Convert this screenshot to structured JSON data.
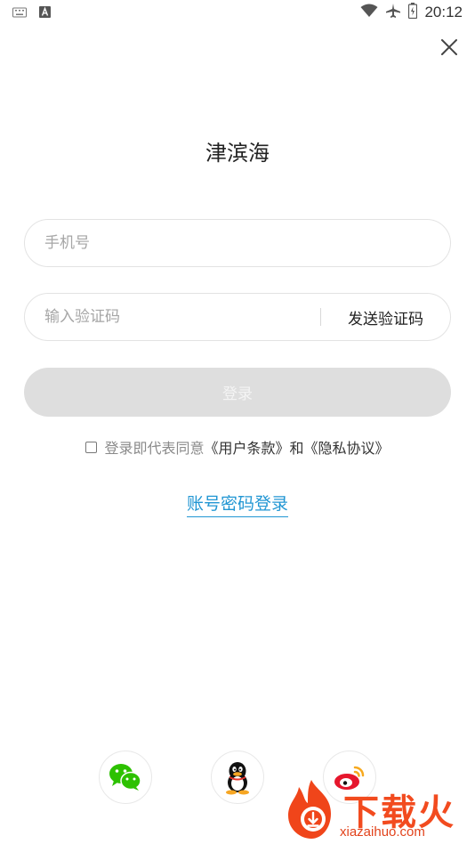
{
  "status_bar": {
    "time": "20:12",
    "left_icons": [
      "keyboard-icon",
      "a-icon"
    ],
    "right_icons": [
      "wifi-icon",
      "airplane-icon",
      "battery-icon"
    ]
  },
  "header": {
    "close_icon": "close-icon"
  },
  "app": {
    "title": "津滨海"
  },
  "form": {
    "phone_placeholder": "手机号",
    "phone_value": "",
    "code_placeholder": "输入验证码",
    "code_value": "",
    "send_code_label": "发送验证码",
    "login_label": "登录"
  },
  "agreement": {
    "checked": false,
    "prefix": "登录即代表同意",
    "terms_link": "《用户条款》",
    "and": "和",
    "privacy_link": "《隐私协议》"
  },
  "password_login_label": "账号密码登录",
  "social_login": [
    "wechat-icon",
    "qq-icon",
    "weibo-icon"
  ],
  "watermark": {
    "text": "下载火",
    "url": "xiazaihuo.com"
  },
  "colors": {
    "accent_link": "#2196d3",
    "login_button_disabled": "#dedede",
    "wechat_green": "#2dc100",
    "watermark_red": "#f24b1f"
  }
}
